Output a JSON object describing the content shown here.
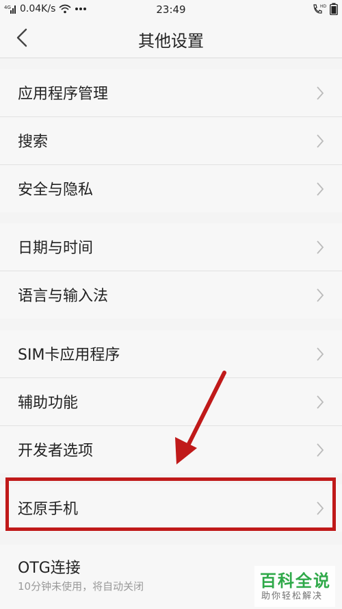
{
  "status_bar": {
    "network_speed": "0.04K/s",
    "time": "23:49",
    "hd_label": "HD"
  },
  "header": {
    "title": "其他设置"
  },
  "groups": [
    {
      "items": [
        {
          "label": "应用程序管理"
        },
        {
          "label": "搜索"
        },
        {
          "label": "安全与隐私"
        }
      ]
    },
    {
      "items": [
        {
          "label": "日期与时间"
        },
        {
          "label": "语言与输入法"
        }
      ]
    },
    {
      "items": [
        {
          "label": "SIM卡应用程序"
        },
        {
          "label": "辅助功能"
        },
        {
          "label": "开发者选项"
        }
      ]
    },
    {
      "items": [
        {
          "label": "还原手机"
        }
      ]
    },
    {
      "items": [
        {
          "label": "OTG连接",
          "subtitle": "10分钟未使用，将自动关闭"
        }
      ]
    }
  ],
  "watermark": {
    "title": "百科全说",
    "subtitle": "助你轻松解决"
  },
  "colors": {
    "annotation": "#c01a1a",
    "watermark": "#1fa33b"
  }
}
